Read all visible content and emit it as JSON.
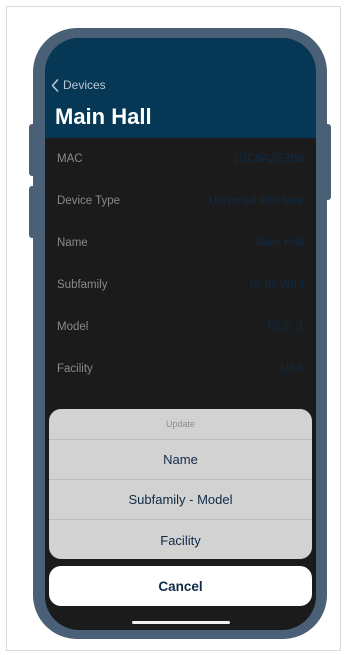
{
  "header": {
    "back_label": "Devices",
    "title": "Main Hall"
  },
  "details": [
    {
      "label": "MAC",
      "value": "1DC9A2E2B8"
    },
    {
      "label": "Device Type",
      "value": "Universal interface"
    },
    {
      "label": "Name",
      "value": "Main Hall"
    },
    {
      "label": "Subfamily",
      "value": "IS-IR-WIFI"
    },
    {
      "label": "Model",
      "value": "RCF_1"
    },
    {
      "label": "Facility",
      "value": "USA"
    }
  ],
  "action_sheet": {
    "title": "Update",
    "options": [
      "Name",
      "Subfamily - Model",
      "Facility"
    ],
    "cancel_label": "Cancel"
  },
  "colors": {
    "header_bg": "#063855",
    "frame": "#4a6076",
    "text_accent": "#0f2b45"
  }
}
